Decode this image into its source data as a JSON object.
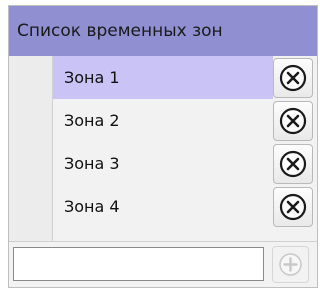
{
  "panel": {
    "title": "Список временных зон"
  },
  "zones": [
    {
      "label": "Зона 1",
      "selected": true
    },
    {
      "label": "Зона 2",
      "selected": false
    },
    {
      "label": "Зона 3",
      "selected": false
    },
    {
      "label": "Зона 4",
      "selected": false
    }
  ],
  "row_actions": {
    "delete_icon": "close-circle-icon"
  },
  "footer": {
    "input_value": "",
    "add_icon": "plus-circle-icon"
  },
  "colors": {
    "header": "#8f8fd1",
    "selected_row": "#c9c4f5",
    "background": "#f2f2f2"
  }
}
